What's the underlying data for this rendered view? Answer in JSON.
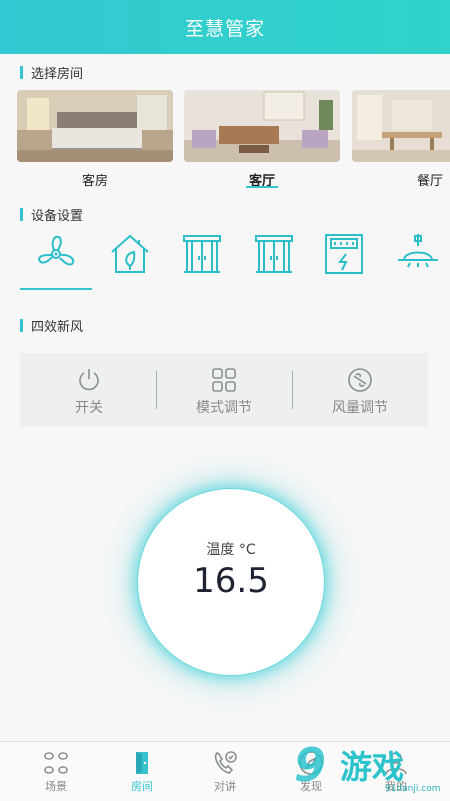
{
  "header": {
    "title": "至慧管家"
  },
  "sections": {
    "rooms_title": "选择房间",
    "devices_title": "设备设置",
    "fresh_air_title": "四效新风"
  },
  "rooms": [
    {
      "label": "客房",
      "active": false
    },
    {
      "label": "客厅",
      "active": true
    },
    {
      "label": "餐厅",
      "active": false
    }
  ],
  "devices": [
    {
      "icon": "fan-icon",
      "active": true
    },
    {
      "icon": "home-icon",
      "active": false
    },
    {
      "icon": "curtain-icon",
      "active": false
    },
    {
      "icon": "curtain-icon",
      "active": false
    },
    {
      "icon": "power-panel-icon",
      "active": false
    },
    {
      "icon": "ceiling-lamp-icon",
      "active": false
    }
  ],
  "controls": {
    "power": "开关",
    "mode": "模式调节",
    "fan_speed": "风量调节"
  },
  "dial": {
    "label": "温度 °C",
    "value": "16.5"
  },
  "tabs": [
    {
      "label": "场景",
      "icon": "grid-icon"
    },
    {
      "label": "房间",
      "icon": "door-icon",
      "active": true
    },
    {
      "label": "对讲",
      "icon": "phone-icon"
    },
    {
      "label": "发现",
      "icon": "compass-icon"
    },
    {
      "label": "我的",
      "icon": "user-icon"
    }
  ],
  "watermark": {
    "number": "9",
    "text": "游戏",
    "site": "91danji.com"
  },
  "colors": {
    "accent": "#34c3cf",
    "header": "#34c9d2"
  }
}
